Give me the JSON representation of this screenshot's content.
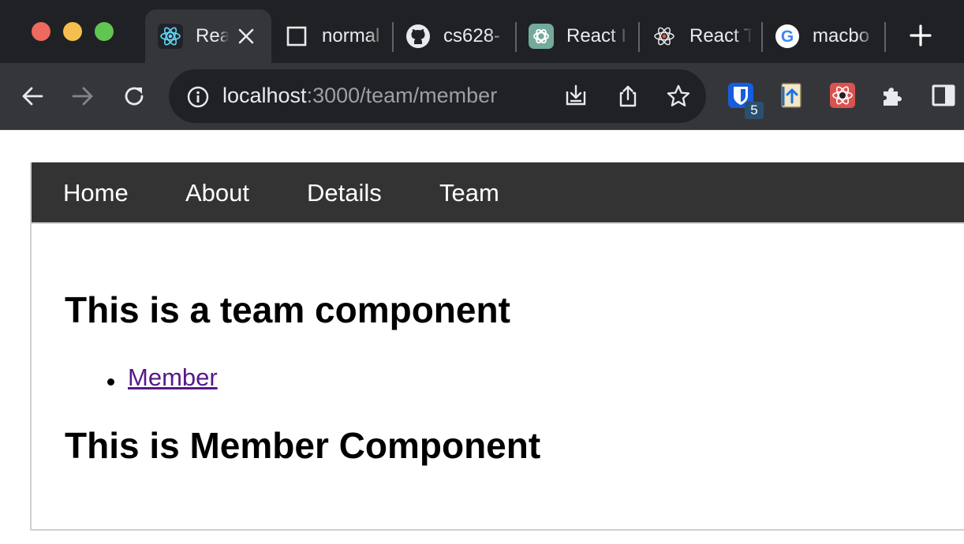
{
  "browser": {
    "tabs": [
      {
        "title": "Rea",
        "icon": "react-icon",
        "active": true
      },
      {
        "title": "normal",
        "icon": "blank-page-icon"
      },
      {
        "title": "cs628-",
        "icon": "github-icon"
      },
      {
        "title": "React I",
        "icon": "chatgpt-icon"
      },
      {
        "title": "React T",
        "icon": "react-icon"
      },
      {
        "title": "macbo",
        "icon": "google-icon"
      }
    ],
    "address": {
      "host": "localhost",
      "path": ":3000/team/member"
    },
    "extensions": {
      "bitwarden_badge": "5"
    }
  },
  "page": {
    "nav": {
      "home": "Home",
      "about": "About",
      "details": "Details",
      "team": "Team"
    },
    "team_heading": "This is a team component",
    "member_link": "Member",
    "member_heading": "This is Member Component"
  },
  "colors": {
    "tabstrip": "#202124",
    "toolbar": "#35363a",
    "navbar": "#333333",
    "visited_link": "#551a8b"
  }
}
